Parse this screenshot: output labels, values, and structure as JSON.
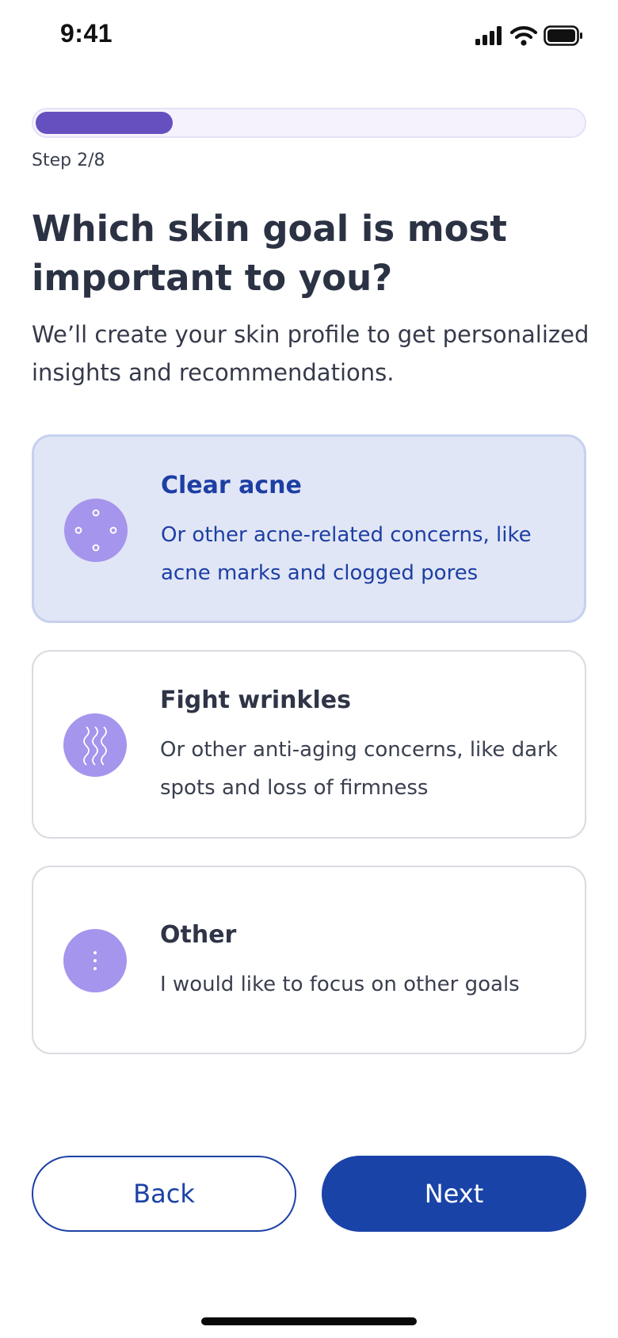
{
  "status_bar": {
    "time": "9:41",
    "icons": [
      "signal-icon",
      "wifi-icon",
      "battery-icon"
    ]
  },
  "progress": {
    "fraction": 0.25,
    "step_label": "Step 2/8",
    "fill_color": "#6650c0"
  },
  "heading": {
    "title": "Which skin goal is most important to you?",
    "subtitle": "We’ll create your skin profile to get personalized insights and recommendations."
  },
  "options": [
    {
      "title": "Clear acne",
      "description": "Or other acne-related concerns, like acne marks and clogged pores",
      "icon": "dots-circle-icon",
      "selected": true
    },
    {
      "title": "Fight wrinkles",
      "description": "Or other anti-aging concerns, like dark spots and loss of firmness",
      "icon": "waves-icon",
      "selected": false
    },
    {
      "title": "Other",
      "description": "I would like to focus on other goals",
      "icon": "vertical-dots-icon",
      "selected": false
    }
  ],
  "actions": {
    "back_label": "Back",
    "next_label": "Next"
  },
  "colors": {
    "accent": "#1a43a8",
    "selected_card_bg": "#e1e6f6",
    "icon_bg": "#a595ed"
  }
}
